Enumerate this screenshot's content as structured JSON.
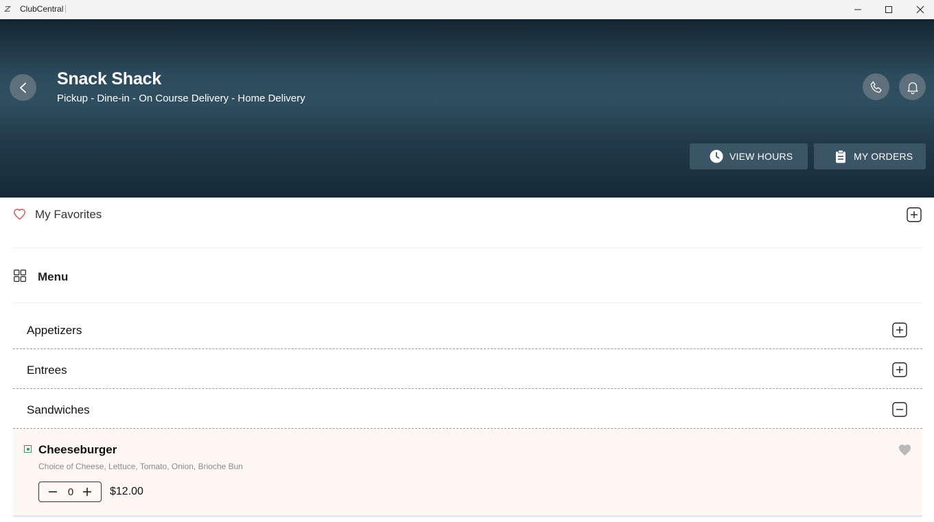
{
  "window": {
    "title": "ClubCentral",
    "app_icon": "clubcentral-logo",
    "app_icon_glyph": "ℤ"
  },
  "hero": {
    "title": "Snack Shack",
    "subtitle": "Pickup - Dine-in - On Course Delivery - Home Delivery",
    "back_icon": "chevron-left-icon",
    "call_icon": "phone-icon",
    "notify_icon": "bell-icon",
    "view_hours_label": "VIEW HOURS",
    "my_orders_label": "MY ORDERS"
  },
  "favorites": {
    "label": "My Favorites",
    "icon": "heart-outline-icon",
    "toggle_icon": "plus-square-icon"
  },
  "menu": {
    "label": "Menu",
    "icon": "grid-icon",
    "categories": [
      {
        "label": "Appetizers",
        "expanded": false
      },
      {
        "label": "Entrees",
        "expanded": false
      },
      {
        "label": "Sandwiches",
        "expanded": true
      }
    ],
    "items": [
      {
        "name": "Cheeseburger",
        "description": "Choice of Cheese, Lettuce, Tomato, Onion, Brioche Bun",
        "quantity": "0",
        "price": "$12.00",
        "favorited": false
      }
    ]
  },
  "colors": {
    "hero_dark": "#132530",
    "hero_mid": "#2f4f61",
    "button_bg": "#3a5566",
    "round_button_bg": "#5e707c",
    "favorite_heart": "#d9534f",
    "veg_mark": "#2e9d5a",
    "item_card_bg": "#fdf7f4"
  }
}
